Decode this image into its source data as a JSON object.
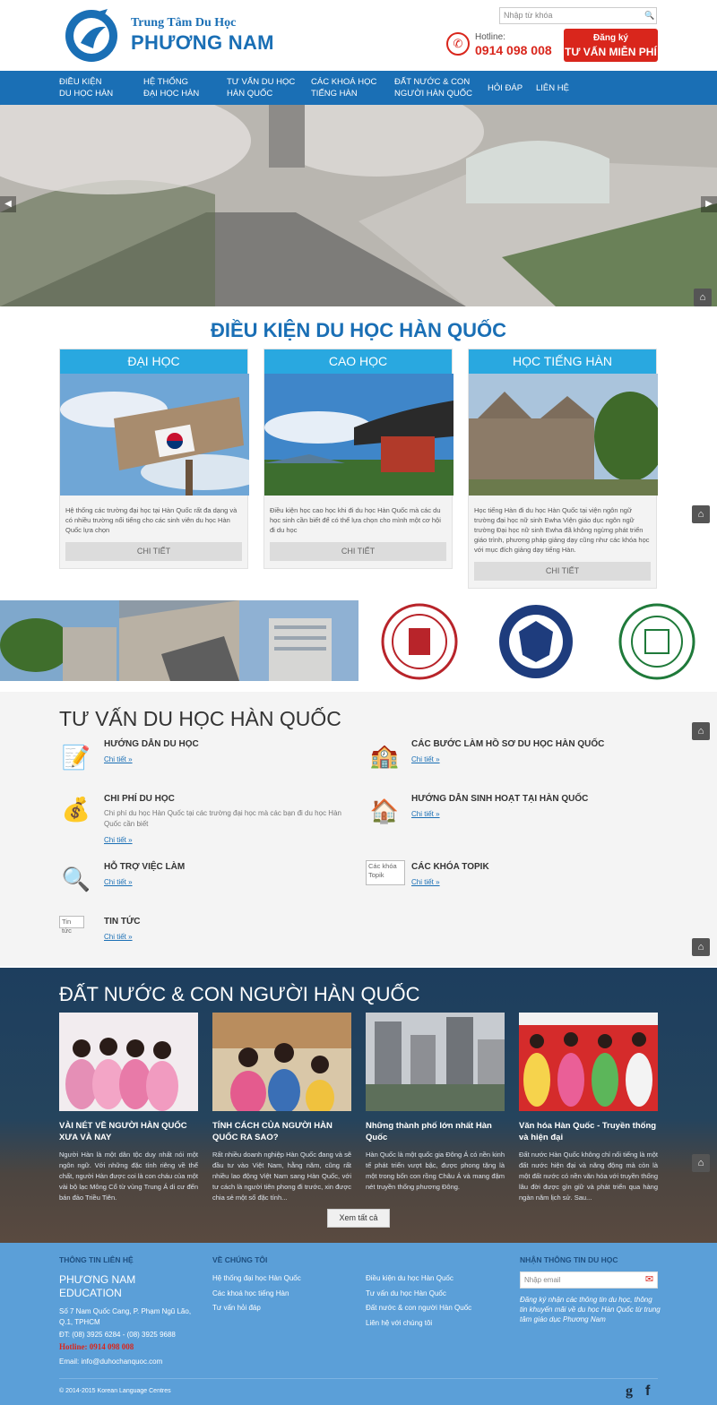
{
  "header": {
    "brand_line1": "Trung Tâm Du Học",
    "brand_line2": "PHƯƠNG NAM",
    "search_placeholder": "Nhập từ khóa",
    "hotline_label": "Hotline:",
    "hotline_number": "0914 098 008",
    "register_line1": "Đăng ký",
    "register_line2": "TƯ VẤN MIỄN PHÍ"
  },
  "nav": [
    {
      "line1": "Điều kiện",
      "line2": "du học Hàn"
    },
    {
      "line1": "Hệ thống",
      "line2": "đại học Hàn"
    },
    {
      "line1": "Tư vấn du học",
      "line2": "Hàn Quốc"
    },
    {
      "line1": "Các khoá học",
      "line2": "tiếng Hàn"
    },
    {
      "line1": "Đất nước & con",
      "line2": "người Hàn Quốc"
    },
    {
      "line1": "Hỏi đáp",
      "line2": ""
    },
    {
      "line1": "Liên hệ",
      "line2": ""
    }
  ],
  "conditions": {
    "title": "Điều kiện du học Hàn Quốc",
    "cards": [
      {
        "head": "Đại học",
        "text": "Hệ thống các trường đại học tại Hàn Quốc rất đa dạng và có nhiều trường nổi tiếng cho các sinh viên du học Hàn Quốc lựa chọn",
        "button": "Chi tiết"
      },
      {
        "head": "Cao học",
        "text": "Điều kiện học cao học khi đi du học Hàn Quốc mà các du học sinh cần biết để có thể lựa chọn cho mình một cơ hội đi du học",
        "button": "Chi tiết"
      },
      {
        "head": "Học tiếng Hàn",
        "text": "Học tiếng Hàn đi du học Hàn Quốc tại viện ngôn ngữ trường đại học nữ sinh Ewha Viện giáo dục ngôn ngữ trường Đại học nữ sinh Ewha đã không ngừng phát triển giáo trình, phương pháp giảng dạy cũng như các khóa học với mục đích giảng dạy tiếng Hàn.",
        "button": "Chi tiết"
      }
    ]
  },
  "consult": {
    "title": "Tư vấn du học Hàn Quốc",
    "items": [
      {
        "title": "Hướng dẫn du học",
        "desc": "",
        "link": "Chi tiết »",
        "icon": "document-edit-icon"
      },
      {
        "title": "Các bước làm hồ sơ du học Hàn Quốc",
        "desc": "",
        "link": "Chi tiết »",
        "icon": "school-building-icon"
      },
      {
        "title": "Chi phí du học",
        "desc": "Chi phí du học Hàn Quốc tại các trường đại học mà các bạn đi du học Hàn Quốc cần biết",
        "link": "Chi tiết »",
        "icon": "money-hand-icon"
      },
      {
        "title": "Hướng dẫn sinh hoạt tại Hàn Quốc",
        "desc": "",
        "link": "Chi tiết »",
        "icon": "house-family-icon"
      },
      {
        "title": "Hỗ trợ việc làm",
        "desc": "",
        "link": "Chi tiết »",
        "icon": "resume-search-icon"
      },
      {
        "title": "Các khóa topik",
        "desc": "",
        "link": "Chi tiết »",
        "icon_alt": "Các khóa Topik"
      },
      {
        "title": "Tin tức",
        "desc": "",
        "link": "Chi tiết »",
        "icon_alt": "Tin tức"
      }
    ]
  },
  "country": {
    "title": "Đất nước & con người Hàn Quốc",
    "articles": [
      {
        "title": "Vài nét về người Hàn Quốc xưa và nay",
        "text": "Người Hàn là một dân tộc duy nhất nói một ngôn ngữ. Với những đặc tính riêng về thể chất, người Hàn được coi là con cháu của một vài bộ lạc Mông Cổ từ vùng Trung Á di cư đến bán đảo Triều Tiên."
      },
      {
        "title": "Tính cách của người Hàn Quốc ra sao?",
        "text": "Rất nhiều doanh nghiệp Hàn Quốc đang và sẽ đầu tư vào Việt Nam, hằng năm, cũng rất nhiều lao động Việt Nam sang Hàn Quốc, với tư cách là người tiên phong đi trước, xin được chia sẻ một số đặc tính..."
      },
      {
        "title": "Những thành phố lớn nhất Hàn Quốc",
        "text": "Hàn Quốc là một quốc gia Đông Á có nền kinh tế phát triển vượt bậc, được phong tặng là một trong bốn con rồng Châu Á và mang đậm nét truyền thống phương Đông."
      },
      {
        "title": "Văn hóa Hàn Quốc - Truyền thống và hiện đại",
        "text": "Đất nước Hàn Quốc không chỉ nổi tiếng là một đất nước hiện đại và năng động mà còn là một đất nước có nền văn hóa với truyền thống lâu đời được gìn giữ và phát triển qua hàng ngàn năm lịch sử. Sau..."
      }
    ],
    "view_all": "Xem tất cả"
  },
  "footer": {
    "contact_head": "Thông tin liên hệ",
    "company_line1": "PHƯƠNG NAM",
    "company_line2": "EDUCATION",
    "address_line1": "Số 7 Nam Quốc Cang, P. Phạm Ngũ Lão,",
    "address_line2": "Q.1, TPHCM",
    "phone": "ĐT: (08) 3925 6284 - (08) 3925 9688",
    "hotline": "Hotline: 0914 098 008",
    "email": "Email: info@duhochanquoc.com",
    "about_head": "Về chúng tôi",
    "about_links": [
      "Hệ thống đại học Hàn Quốc",
      "Các khoá học tiếng Hàn",
      "Tư vấn hỏi đáp"
    ],
    "more_links": [
      "Điều kiện du học Hàn Quốc",
      "Tư vấn du học Hàn Quốc",
      "Đất nước & con người Hàn Quốc",
      "Liên hệ với chúng tôi"
    ],
    "newsletter_head": "Nhận thông tin du học",
    "email_placeholder": "Nhập email",
    "newsletter_note": "Đăng ký nhận các thông tin du học, thông tin khuyến mãi về du học Hàn Quốc từ trung tâm giáo dục Phương Nam",
    "copyright": "© 2014-2015 Korean Language Centres",
    "social": [
      "g",
      "f"
    ]
  },
  "colors": {
    "primary": "#1a6fb5",
    "accent": "#d9261c",
    "card_head": "#29a8e0",
    "footer": "#5b9fd8"
  }
}
